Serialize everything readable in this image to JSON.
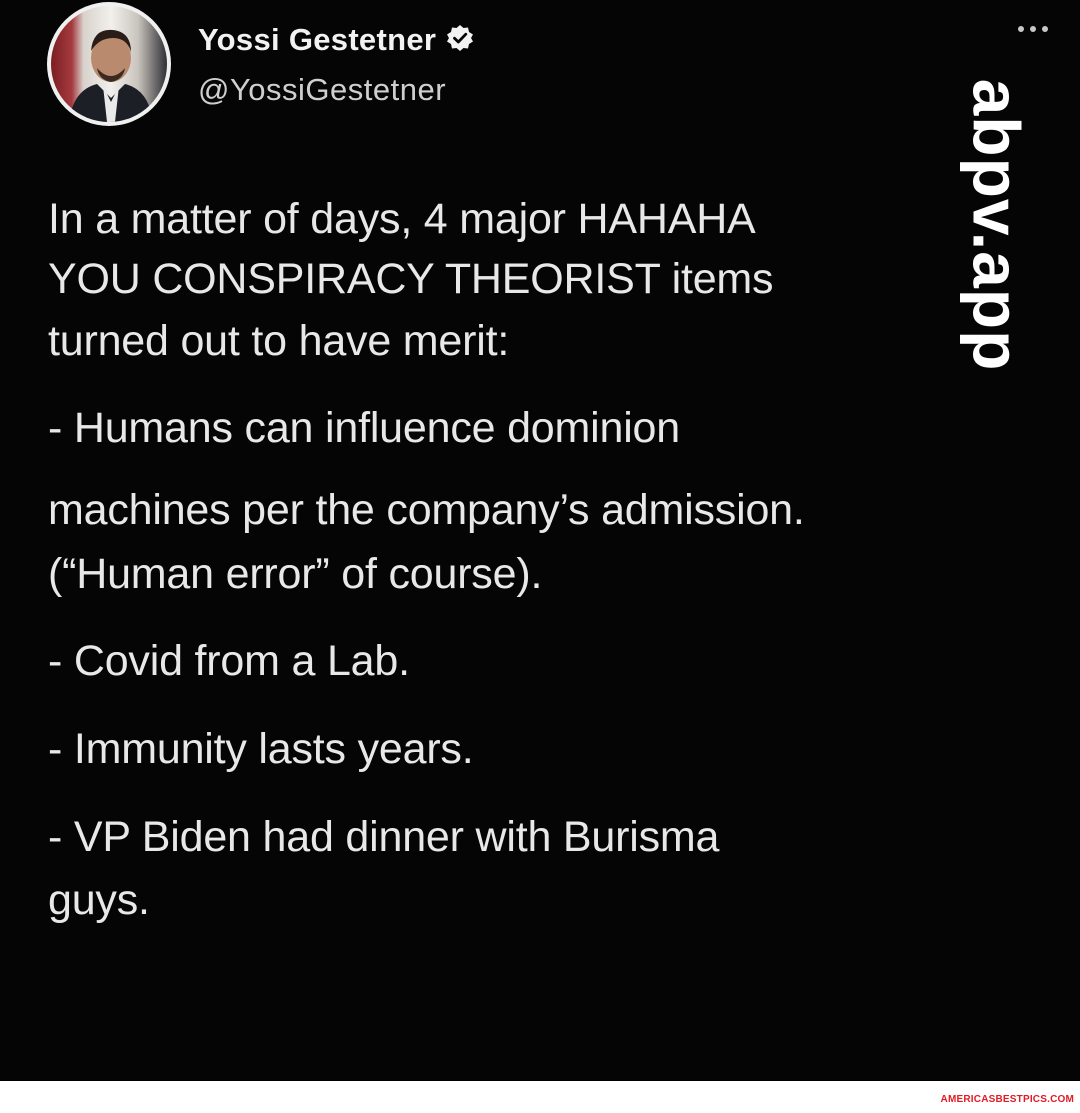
{
  "user": {
    "display_name": "Yossi Gestetner",
    "handle": "@YossiGestetner",
    "verified_icon": "verified-badge-icon"
  },
  "tweet": {
    "lines": [
      "In a matter of days, 4 major HAHAHA",
      "YOU CONSPIRACY THEORIST items",
      "turned out to have merit:",
      "- Humans can influence dominion",
      "machines per the company’s admission.",
      "(“Human error” of course).",
      "- Covid from a Lab.",
      "- Immunity lasts years.",
      "- VP Biden had dinner with Burisma",
      "guys."
    ]
  },
  "watermark": {
    "text": "abpv.app"
  },
  "footer": {
    "credit": "AMERICASBESTPICS.COM"
  },
  "colors": {
    "background": "#050505",
    "text": "#e8e8e8",
    "credit": "#e01b24"
  }
}
